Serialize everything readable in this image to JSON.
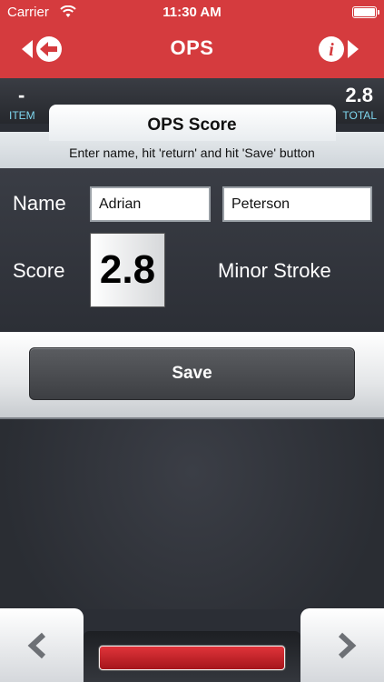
{
  "status_bar": {
    "carrier": "Carrier",
    "time": "11:30 AM"
  },
  "nav": {
    "title": "OPS"
  },
  "counters": {
    "item_value": "-",
    "item_label": "ITEM",
    "total_value": "2.8",
    "total_label": "TOTAL"
  },
  "panel": {
    "title": "OPS Score",
    "instruction": "Enter name, hit 'return' and hit 'Save' button"
  },
  "form": {
    "name_label": "Name",
    "first_name": "Adrian",
    "last_name": "Peterson",
    "score_label": "Score",
    "score_value": "2.8",
    "score_category": "Minor Stroke"
  },
  "actions": {
    "save_label": "Save"
  },
  "colors": {
    "header_red": "#d53b3e",
    "counter_label_cyan": "#7fd7ef",
    "dark_background": "#2b2e35"
  },
  "icons": {
    "back": "back-arrow-icon",
    "info": "info-icon",
    "prev": "chevron-left-icon",
    "next": "chevron-right-icon",
    "wifi": "wifi-icon",
    "battery": "battery-icon"
  }
}
